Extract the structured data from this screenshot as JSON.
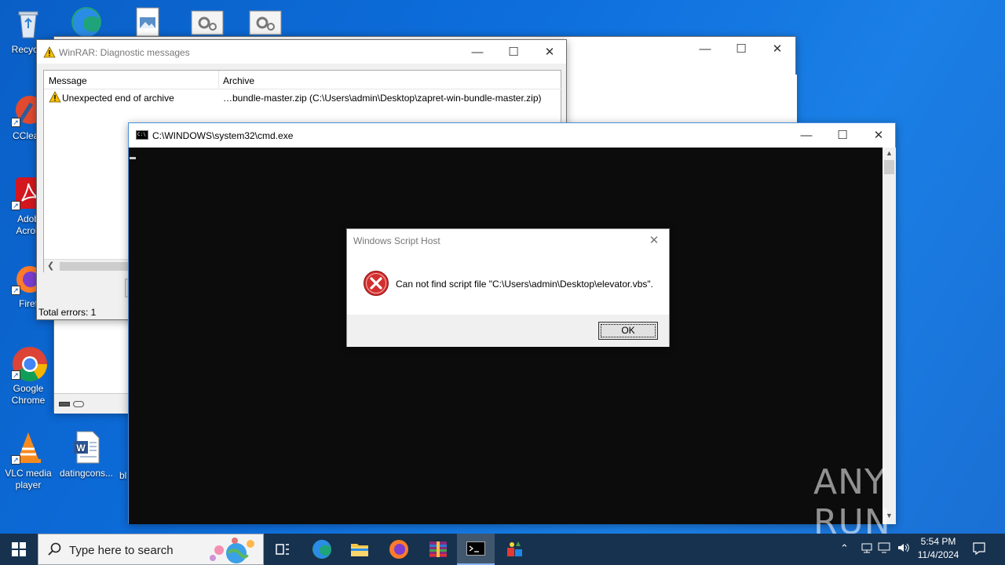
{
  "desktop": {
    "icons": {
      "recycle": "Recycle",
      "ccleaner": "CClean",
      "adobe_line1": "Adob",
      "adobe_line2": "Acrob",
      "firefox": "Firef",
      "chrome_line1": "Google",
      "chrome_line2": "Chrome",
      "vlc_line1": "VLC media",
      "vlc_line2": "player",
      "word_doc": "datingcons...",
      "bl": "bl"
    }
  },
  "winrar_diag": {
    "title": "WinRAR: Diagnostic messages",
    "columns": [
      "Message",
      "Archive"
    ],
    "rows": [
      {
        "message": "Unexpected end of archive",
        "archive": "…bundle-master.zip (C:\\Users\\admin\\Desktop\\zapret-win-bundle-master.zip)"
      }
    ],
    "total": "Total errors: 1"
  },
  "cmd": {
    "title": "C:\\WINDOWS\\system32\\cmd.exe",
    "icon_text": "C:\\"
  },
  "wsh": {
    "title": "Windows Script Host",
    "message": "Can not find script file \"C:\\Users\\admin\\Desktop\\elevator.vbs\".",
    "ok": "OK"
  },
  "taskbar": {
    "search_placeholder": "Type here to search",
    "time": "5:54 PM",
    "date": "11/4/2024"
  },
  "watermark": {
    "text": "ANY RUN"
  },
  "colors": {
    "taskbar": "#17324f",
    "error_red": "#d32f2f",
    "desktop": "#0d6edc"
  }
}
